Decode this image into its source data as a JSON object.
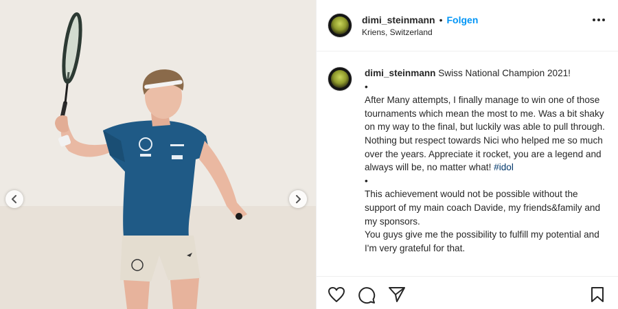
{
  "media": {
    "prev_arrow_icon": "chevron-left-icon",
    "next_arrow_icon": "chevron-right-icon",
    "photo_icon": "squash-player-photo"
  },
  "header": {
    "username": "dimi_steinmann",
    "separator": "•",
    "follow_label": "Folgen",
    "location": "Kriens, Switzerland",
    "more_icon": "more-options-icon"
  },
  "caption": {
    "username": "dimi_steinmann",
    "lines": [
      "Swiss National Champion 2021!",
      "•",
      "After Many attempts, I finally manage to win one of those tournaments which mean the most to me. Was a bit shaky on my way to the final, but luckily was able to pull through. Nothing but respect towards Nici who helped me so much over the years. Appreciate it rocket, you are a legend and always will be, no matter what!",
      "#idol",
      "•",
      "This achievement would not be possible without the support of my main coach Davide, my friends&family and my sponsors.",
      "You guys give me the possibility to fulfill my potential and I'm very grateful for that."
    ]
  },
  "actions": {
    "like_icon": "heart-icon",
    "comment_icon": "comment-icon",
    "share_icon": "share-icon",
    "save_icon": "bookmark-icon"
  },
  "colors": {
    "link_blue": "#0095f6",
    "hashtag": "#00376b",
    "text": "#262626",
    "divider": "#efefef"
  }
}
